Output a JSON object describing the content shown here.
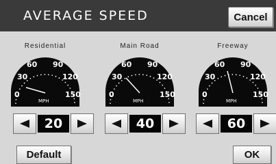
{
  "header": {
    "title": "AVERAGE SPEED",
    "cancel_label": "Cancel"
  },
  "gauges": [
    {
      "label": "Residential",
      "value": "20"
    },
    {
      "label": "Main Road",
      "value": "40"
    },
    {
      "label": "Freeway",
      "value": "60"
    }
  ],
  "dial": {
    "ticks": [
      "0",
      "30",
      "60",
      "90",
      "120",
      "150"
    ],
    "unit": "MPH"
  },
  "footer": {
    "default_label": "Default",
    "ok_label": "OK"
  }
}
